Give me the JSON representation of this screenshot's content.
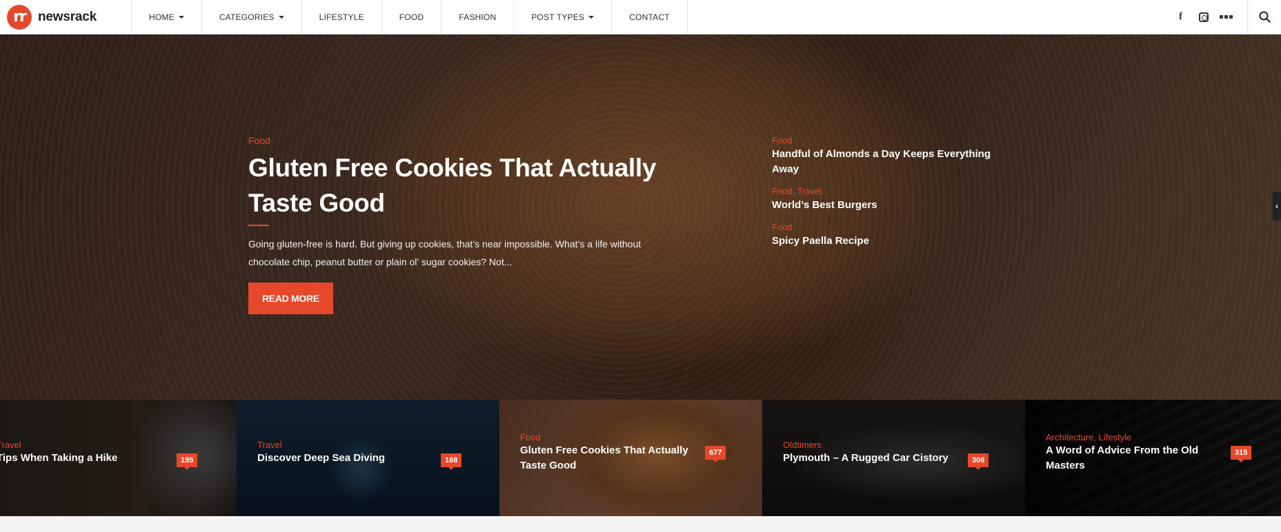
{
  "header": {
    "logo_mark": "rr",
    "logo_text": "newsrack",
    "nav": [
      {
        "label": "HOME",
        "has_dropdown": true
      },
      {
        "label": "CATEGORIES",
        "has_dropdown": true
      },
      {
        "label": "LIFESTYLE",
        "has_dropdown": false
      },
      {
        "label": "FOOD",
        "has_dropdown": false
      },
      {
        "label": "FASHION",
        "has_dropdown": false
      },
      {
        "label": "POST TYPES",
        "has_dropdown": true
      },
      {
        "label": "CONTACT",
        "has_dropdown": false
      }
    ],
    "social": [
      "facebook-icon",
      "instagram-icon",
      "more-icon"
    ],
    "search_icon": "search-icon"
  },
  "hero": {
    "category": "Food",
    "title": "Gluten Free Cookies That Actually Taste Good",
    "excerpt": "Going gluten-free is hard. But giving up cookies, that’s near impossible. What’s a life without chocolate chip, peanut butter or plain ol’ sugar cookies? Not...",
    "read_more": "READ MORE",
    "side_posts": [
      {
        "category": "Food",
        "title": "Handful of Almonds a Day Keeps Everything Away"
      },
      {
        "category": "Food, Travel",
        "title": "World’s Best Burgers"
      },
      {
        "category": "Food",
        "title": "Spicy Paella Recipe"
      }
    ],
    "toggle_icon": "‹"
  },
  "tiles": [
    {
      "category": "Travel",
      "title": "Tips When Taking a Hike",
      "count": "195"
    },
    {
      "category": "Travel",
      "title": "Discover Deep Sea Diving",
      "count": "168"
    },
    {
      "category": "Food",
      "title": "Gluten Free Cookies That Actually Taste Good",
      "count": "677"
    },
    {
      "category": "Oldtimers",
      "title": "Plymouth – A Rugged Car Cistory",
      "count": "306"
    },
    {
      "category": "Architecture, Lifestyle",
      "title": "A Word of Advice From the Old Masters",
      "count": "315"
    }
  ],
  "colors": {
    "accent": "#e5482b",
    "text_dark": "#222222"
  }
}
